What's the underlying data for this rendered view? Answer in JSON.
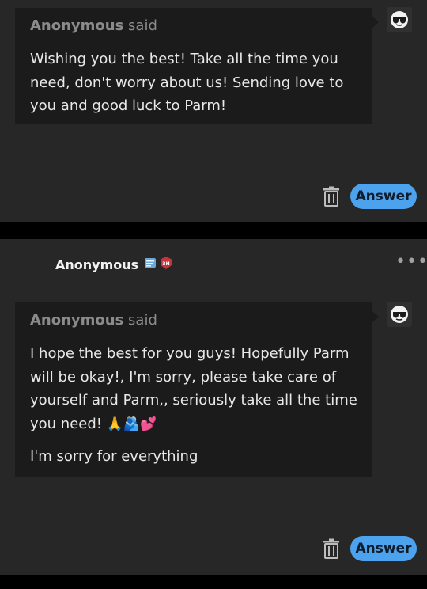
{
  "post1": {
    "asker_name": "Anonymous",
    "said": "said",
    "question": "Wishing you the best! Take all the time you need, don't worry about us! Sending love to you and good luck to Parm!",
    "answer_label": "Answer",
    "avatar_icon": "sunglasses-face-icon",
    "delete_icon": "trash-icon"
  },
  "post2": {
    "header_name": "Anonymous",
    "more_label": "•••",
    "asker_name": "Anonymous",
    "said": "said",
    "question": "I hope the best for you guys! Hopefully Parm will be okay!, I'm sorry, please take care of yourself and Parm,, seriously take all the time you need!",
    "question_emojis": "🙏🫂💕",
    "question_extra": "I'm sorry for everything",
    "answer_label": "Answer",
    "avatar_icon": "sunglasses-face-icon",
    "delete_icon": "trash-icon",
    "badges": [
      "scroll-badge-icon",
      "shield-badge-icon"
    ]
  },
  "colors": {
    "background": "#000000",
    "card": "#272727",
    "bubble": "#1b1b1b",
    "accent": "#4da2ee"
  }
}
